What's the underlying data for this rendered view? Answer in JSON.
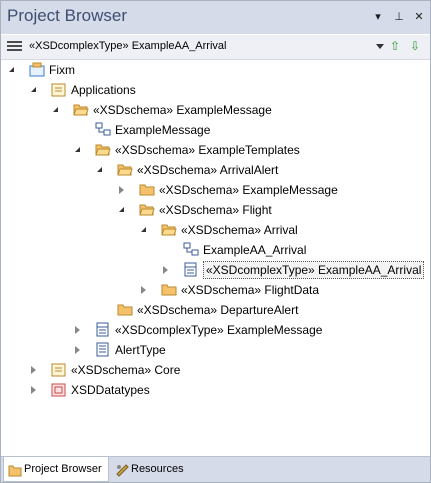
{
  "window": {
    "title": "Project Browser"
  },
  "titlebar_buttons": {
    "dropdown": "▾",
    "pin": "⊥",
    "close": "✕"
  },
  "toolbar": {
    "context": "«XSDcomplexType» ExampleAA_Arrival",
    "up": "⇧",
    "down": "⇩"
  },
  "tree": [
    {
      "label": "Fixm",
      "level": 0,
      "state": "open",
      "icon": "model-root-icon"
    },
    {
      "label": "Applications",
      "level": 1,
      "state": "open",
      "icon": "package-icon"
    },
    {
      "label": "«XSDschema» ExampleMessage",
      "level": 2,
      "state": "open",
      "icon": "folder-open-icon"
    },
    {
      "label": "ExampleMessage",
      "level": 3,
      "state": "none",
      "icon": "diagram-icon"
    },
    {
      "label": "«XSDschema» ExampleTemplates",
      "level": 3,
      "state": "open",
      "icon": "folder-open-icon"
    },
    {
      "label": "«XSDschema» ArrivalAlert",
      "level": 4,
      "state": "open",
      "icon": "folder-open-icon"
    },
    {
      "label": "«XSDschema» ExampleMessage",
      "level": 5,
      "state": "closed",
      "icon": "folder-icon"
    },
    {
      "label": "«XSDschema» Flight",
      "level": 5,
      "state": "open",
      "icon": "folder-open-icon"
    },
    {
      "label": "«XSDschema» Arrival",
      "level": 6,
      "state": "open",
      "icon": "folder-open-icon"
    },
    {
      "label": "ExampleAA_Arrival",
      "level": 7,
      "state": "none",
      "icon": "diagram-icon"
    },
    {
      "label": "«XSDcomplexType» ExampleAA_Arrival",
      "level": 7,
      "state": "closed",
      "icon": "class-icon",
      "selected": true
    },
    {
      "label": "«XSDschema» FlightData",
      "level": 6,
      "state": "closed",
      "icon": "folder-icon"
    },
    {
      "label": "«XSDschema» DepartureAlert",
      "level": 4,
      "state": "none",
      "icon": "folder-icon"
    },
    {
      "label": "«XSDcomplexType» ExampleMessage",
      "level": 3,
      "state": "closed",
      "icon": "class-icon"
    },
    {
      "label": "AlertType",
      "level": 3,
      "state": "closed",
      "icon": "element-icon"
    },
    {
      "label": "«XSDschema» Core",
      "level": 1,
      "state": "closed",
      "icon": "package-icon"
    },
    {
      "label": "XSDDatatypes",
      "level": 1,
      "state": "closed",
      "icon": "datatype-package-icon"
    }
  ],
  "tabs": [
    {
      "label": "Project Browser",
      "active": true,
      "icon": "project-browser-icon"
    },
    {
      "label": "Resources",
      "active": false,
      "icon": "resources-icon"
    }
  ],
  "colors": {
    "titlebar": "#d6dbe9",
    "title_text": "#3c4f71",
    "folder": "#f5c26b",
    "arrow_green": "#2e9a2e"
  }
}
